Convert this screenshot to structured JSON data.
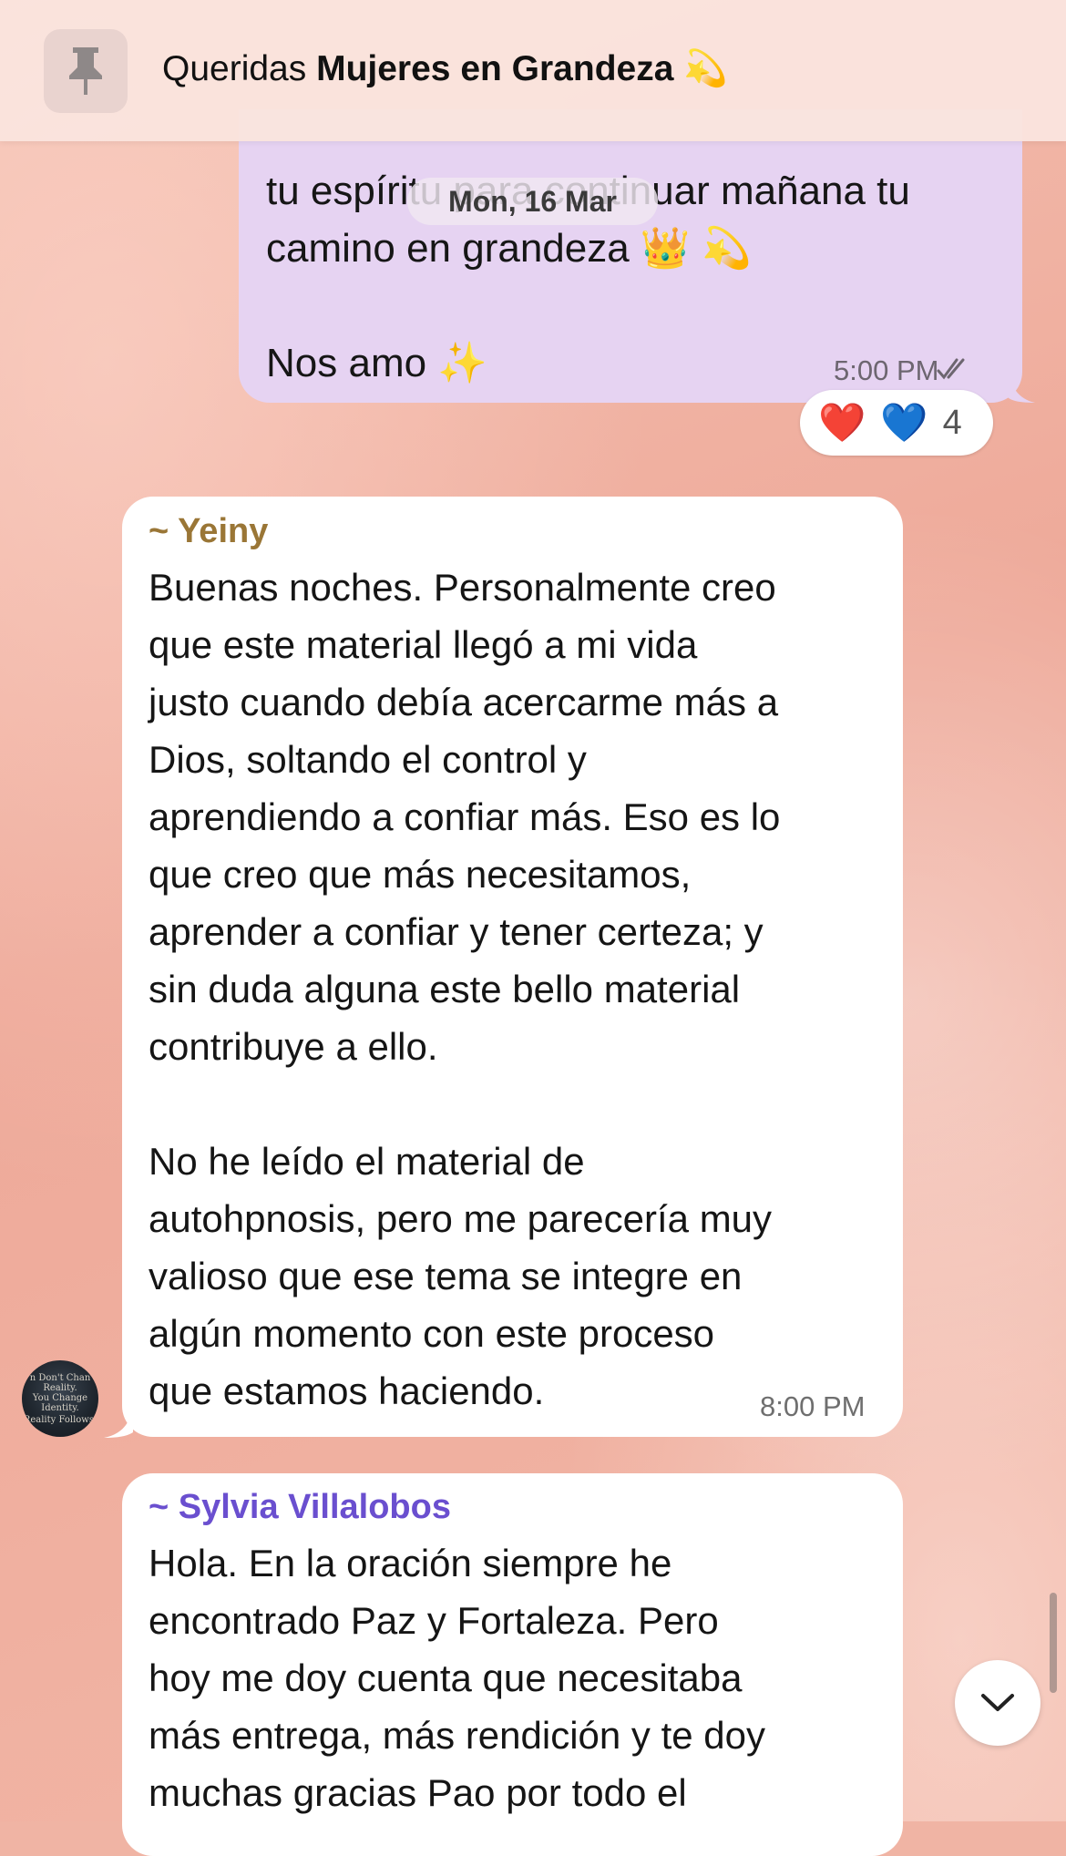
{
  "pinned": {
    "prefix": "Queridas",
    "group_name": "Mujeres en Grandeza",
    "emoji": "💫"
  },
  "date_chip": "Mon, 16 Mar",
  "outgoing": {
    "lines": [
      "tu espíritu para continuar mañana tu",
      "camino en grandeza 👑 💫",
      "",
      "Nos amo ✨"
    ],
    "time": "5:00 PM",
    "reactions": {
      "emojis": [
        "❤️",
        "💙"
      ],
      "count": "4"
    }
  },
  "messages": [
    {
      "sender": "~ Yeiny",
      "sender_color": "#9a7636",
      "lines": [
        "Buenas noches. Personalmente creo",
        "que este material llegó a mi vida",
        "justo cuando debía acercarme más a",
        "Dios, soltando el control y",
        "aprendiendo a confiar más. Eso es lo",
        "que creo que más necesitamos,",
        "aprender a confiar y tener certeza; y",
        "sin duda alguna este bello material",
        "contribuye a ello.",
        "",
        "No he leído el material de",
        "autohpnosis, pero me parecería muy",
        "valioso que ese tema se integre en",
        "algún momento con este proceso",
        "que estamos haciendo."
      ],
      "time": "8:00 PM"
    },
    {
      "sender": "~ Sylvia Villalobos",
      "sender_color": "#6a4fcf",
      "lines": [
        "Hola. En la oración siempre he",
        "encontrado  Paz y Fortaleza. Pero",
        "hoy me doy cuenta que necesitaba",
        "más entrega, más rendición y te doy",
        "muchas gracias Pao por todo el"
      ]
    }
  ],
  "avatar_text": [
    "n Don't Chan",
    "Reality.",
    "You Change",
    "Identity.",
    "Reality Follows."
  ]
}
